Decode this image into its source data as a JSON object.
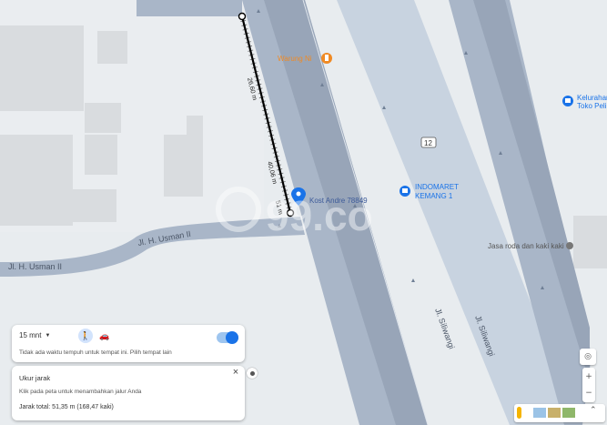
{
  "roads": {
    "usman_upper": "Jl. H. Usman II",
    "usman_lower": "Jl. H. Usman II",
    "highway_left": "Jl. Siliwangi",
    "highway_right": "Jl. Siliwangi",
    "route_shield": "12"
  },
  "pois": {
    "warung": "Warung Ni",
    "indomaret_line1": "INDOMARET",
    "indomaret_line2": "KEMANG 1",
    "kost": "Kost Andre 78849",
    "jasa": "Jasa roda dan kaki kaki",
    "kelurahan_line1": "Kelurahan",
    "kelurahan_line2": "Toko Peli"
  },
  "measure": {
    "seg1": "26,60 m",
    "seg2": "40,06 m",
    "seg3": "51 m"
  },
  "watermark": "99.co",
  "time_panel": {
    "mode": "15 mnt",
    "note": "Tidak ada waktu tempuh untuk tempat ini. Pilih tempat lain"
  },
  "measure_panel": {
    "title": "Ukur jarak",
    "hint": "Klik pada peta untuk menambahkan jalur Anda",
    "total": "Jarak total: 51,35 m (168,47 kaki)",
    "close": "×"
  },
  "colors": {
    "road": "#a9b6c8",
    "road_edge": "#98a5b8",
    "highway_center": "#c8d3e0",
    "building": "#d9dcdf",
    "accent": "#1a73e8",
    "warung": "#f08a24"
  }
}
